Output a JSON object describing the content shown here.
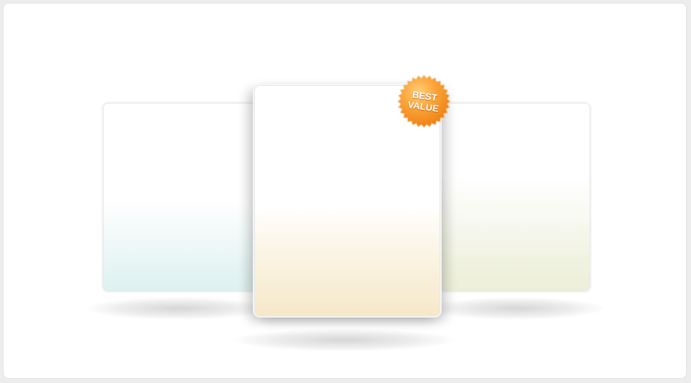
{
  "badge": {
    "line1": "BEST",
    "line2": "VALUE",
    "icon": "starburst-badge-icon",
    "color": "#f58a1f",
    "highlight": "#ffcf7a"
  },
  "cards": [
    {
      "id": "left",
      "accent": "#dff1f0"
    },
    {
      "id": "center",
      "accent": "#f6e8c9",
      "featured": true
    },
    {
      "id": "right",
      "accent": "#edefd9"
    }
  ]
}
